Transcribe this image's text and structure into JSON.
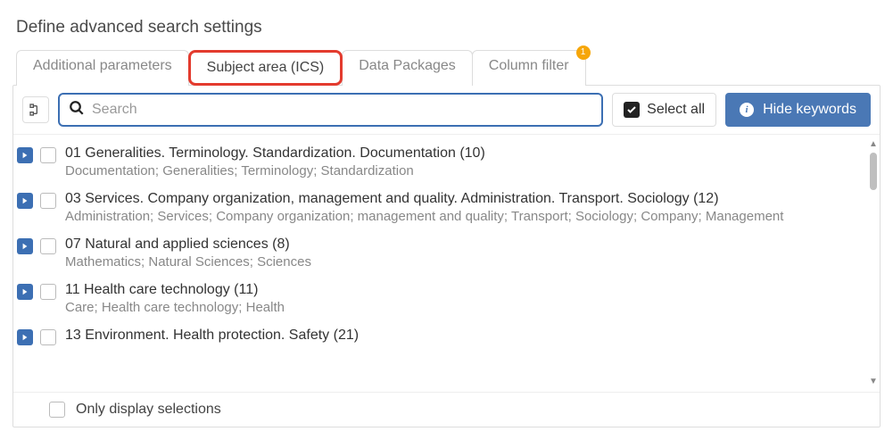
{
  "title": "Define advanced search settings",
  "tabs": [
    {
      "label": "Additional parameters",
      "badge": ""
    },
    {
      "label": "Subject area (ICS)",
      "badge": ""
    },
    {
      "label": "Data Packages",
      "badge": ""
    },
    {
      "label": "Column filter",
      "badge": "1"
    }
  ],
  "toolbar": {
    "search_placeholder": "Search",
    "select_all": "Select all",
    "hide_keywords": "Hide keywords"
  },
  "items": [
    {
      "title": "01 Generalities. Terminology. Standardization. Documentation (10)",
      "keywords": "Documentation; Generalities; Terminology; Standardization"
    },
    {
      "title": "03 Services. Company organization, management and quality. Administration. Transport. Sociology (12)",
      "keywords": "Administration; Services; Company organization; management and quality; Transport; Sociology; Company; Management"
    },
    {
      "title": "07 Natural and applied sciences (8)",
      "keywords": "Mathematics; Natural Sciences; Sciences"
    },
    {
      "title": "11 Health care technology (11)",
      "keywords": "Care; Health care technology; Health"
    },
    {
      "title": "13 Environment. Health protection. Safety (21)",
      "keywords": ""
    }
  ],
  "footer": {
    "only_selections": "Only display selections"
  }
}
